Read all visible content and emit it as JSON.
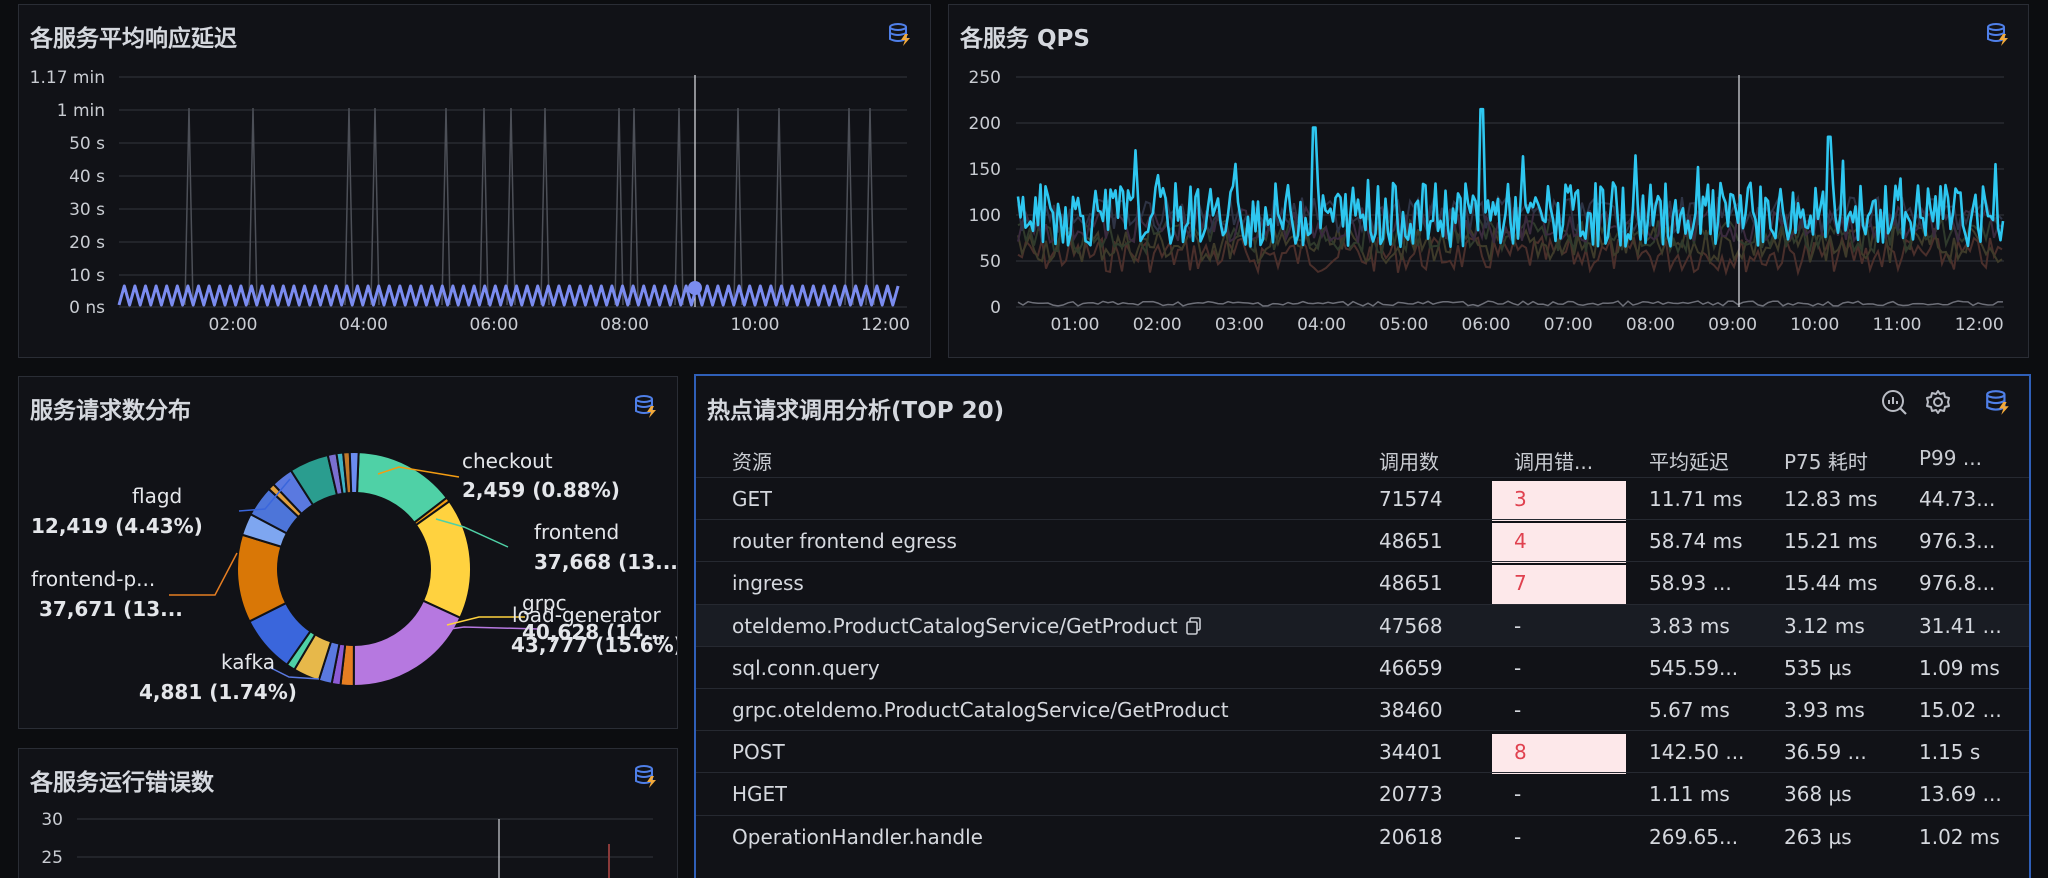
{
  "panels": {
    "latency": {
      "title": "各服务平均响应延迟",
      "y_ticks": [
        "1.17 min",
        "1 min",
        "50 s",
        "40 s",
        "30 s",
        "20 s",
        "10 s",
        "0 ns"
      ],
      "x_ticks": [
        "02:00",
        "04:00",
        "06:00",
        "08:00",
        "10:00",
        "12:00"
      ]
    },
    "qps": {
      "title": "各服务 QPS",
      "y_ticks": [
        "250",
        "200",
        "150",
        "100",
        "50",
        "0"
      ],
      "x_ticks": [
        "01:00",
        "02:00",
        "03:00",
        "04:00",
        "05:00",
        "06:00",
        "07:00",
        "08:00",
        "09:00",
        "10:00",
        "11:00",
        "12:00"
      ]
    },
    "distribution": {
      "title": "服务请求数分布",
      "labels": [
        {
          "name": "checkout",
          "value": "2,459 (0.88%)"
        },
        {
          "name": "flagd",
          "value": "12,419 (4.43%)"
        },
        {
          "name": "frontend",
          "value": "37,668 (13..."
        },
        {
          "name": "frontend-p...",
          "value": "37,671 (13..."
        },
        {
          "name": "grpc",
          "value": ""
        },
        {
          "name": "load-generator",
          "value": "40,628 (14..."
        },
        {
          "name": "",
          "value": "43,777 (15.6%)"
        },
        {
          "name": "kafka",
          "value": "4,881 (1.74%)"
        }
      ]
    },
    "errors": {
      "title": "各服务运行错误数",
      "y_ticks": [
        "30",
        "25"
      ]
    },
    "hot": {
      "title": "热点请求调用分析(TOP 20)",
      "columns": [
        "资源",
        "调用数",
        "调用错...",
        "平均延迟",
        "P75 耗时",
        "P99 ..."
      ],
      "rows": [
        {
          "resource": "GET",
          "calls": "71574",
          "errors": "3",
          "avg": "11.71 ms",
          "p75": "12.83 ms",
          "p99": "44.73..."
        },
        {
          "resource": "router frontend egress",
          "calls": "48651",
          "errors": "4",
          "avg": "58.74 ms",
          "p75": "15.21 ms",
          "p99": "976.3..."
        },
        {
          "resource": "ingress",
          "calls": "48651",
          "errors": "7",
          "avg": "58.93 ...",
          "p75": "15.44 ms",
          "p99": "976.8..."
        },
        {
          "resource": "oteldemo.ProductCatalogService/GetProduct",
          "calls": "47568",
          "errors": "-",
          "avg": "3.83 ms",
          "p75": "3.12 ms",
          "p99": "31.41 ..."
        },
        {
          "resource": "sql.conn.query",
          "calls": "46659",
          "errors": "-",
          "avg": "545.59...",
          "p75": "535 µs",
          "p99": "1.09 ms"
        },
        {
          "resource": "grpc.oteldemo.ProductCatalogService/GetProduct",
          "calls": "38460",
          "errors": "-",
          "avg": "5.67 ms",
          "p75": "3.93 ms",
          "p99": "15.02 ..."
        },
        {
          "resource": "POST",
          "calls": "34401",
          "errors": "8",
          "avg": "142.50 ...",
          "p75": "36.59 ...",
          "p99": "1.15 s"
        },
        {
          "resource": "HGET",
          "calls": "20773",
          "errors": "-",
          "avg": "1.11 ms",
          "p75": "368 µs",
          "p99": "13.69 ..."
        },
        {
          "resource": "OperationHandler.handle",
          "calls": "20618",
          "errors": "-",
          "avg": "269.65...",
          "p75": "263 µs",
          "p99": "1.02 ms"
        }
      ]
    }
  },
  "colors": {
    "latency_line": "#7b8cf0",
    "qps_line": "#2ec7f0",
    "accent": "#3d71d9",
    "error_bg": "#fde8ea",
    "error_text": "#e0414f"
  },
  "icons": [
    "datasource-icon",
    "analysis-icon",
    "gear-icon",
    "copy-icon"
  ]
}
